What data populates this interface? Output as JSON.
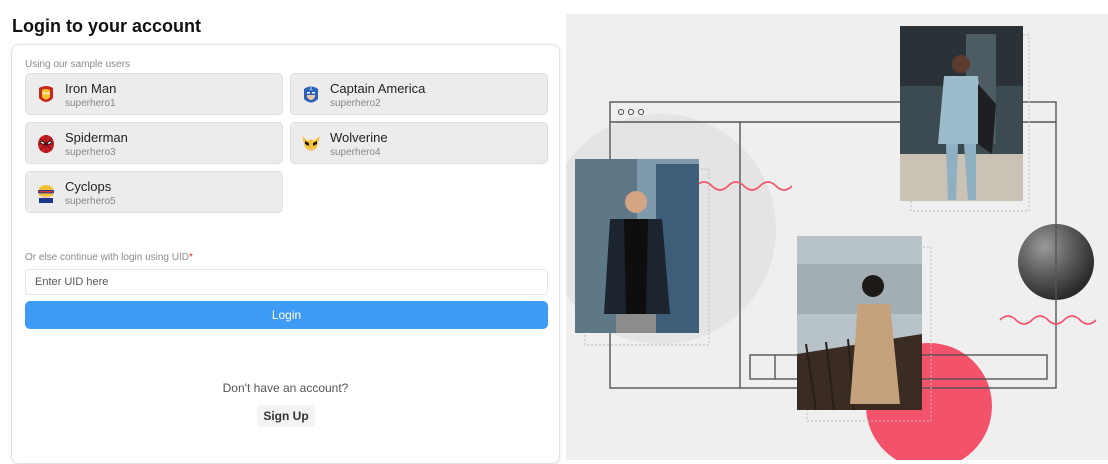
{
  "page": {
    "title": "Login to your account"
  },
  "sample_users": {
    "label": "Using our sample users",
    "users": [
      {
        "name": "Iron Man",
        "uid": "superhero1",
        "icon": "iron-man-icon"
      },
      {
        "name": "Captain America",
        "uid": "superhero2",
        "icon": "captain-america-icon"
      },
      {
        "name": "Spiderman",
        "uid": "superhero3",
        "icon": "spiderman-icon"
      },
      {
        "name": "Wolverine",
        "uid": "superhero4",
        "icon": "wolverine-icon"
      },
      {
        "name": "Cyclops",
        "uid": "superhero5",
        "icon": "cyclops-icon"
      }
    ]
  },
  "uid_login": {
    "label": "Or else continue with login using UID",
    "required_mark": "*",
    "placeholder": "Enter UID here",
    "value": "",
    "button_label": "Login"
  },
  "signup": {
    "prompt": "Don't have an account?",
    "button_label": "Sign Up"
  },
  "colors": {
    "primary": "#3d9bf5",
    "required": "#e02020",
    "accent_pink": "#f2536b",
    "card_bg": "#ececec"
  }
}
